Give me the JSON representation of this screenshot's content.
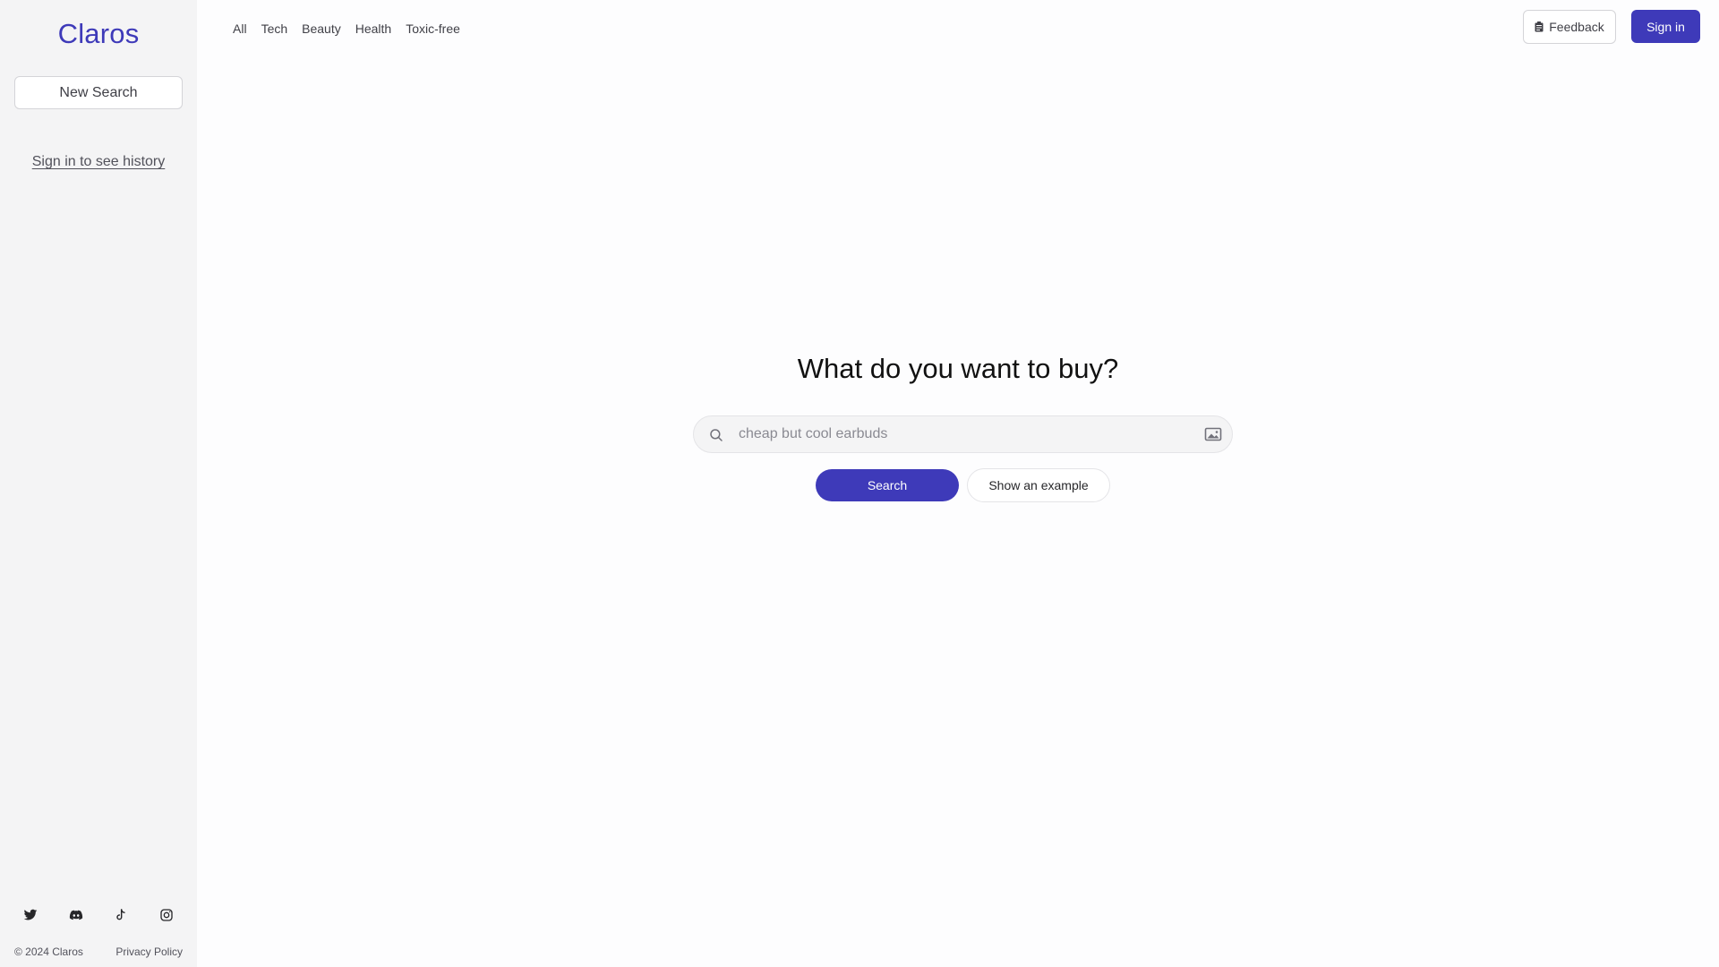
{
  "sidebar": {
    "logo": "Claros",
    "new_search_label": "New Search",
    "history_link": "Sign in to see history",
    "social_icons": [
      "twitter-icon",
      "discord-icon",
      "tiktok-icon",
      "instagram-icon"
    ],
    "copyright": "© 2024 Claros",
    "privacy_link": "Privacy Policy"
  },
  "topnav": {
    "items": [
      {
        "label": "All"
      },
      {
        "label": "Tech"
      },
      {
        "label": "Beauty"
      },
      {
        "label": "Health"
      },
      {
        "label": "Toxic-free"
      }
    ],
    "feedback_label": "Feedback",
    "signin_label": "Sign in"
  },
  "main": {
    "headline": "What do you want to buy?",
    "search": {
      "placeholder": "cheap but cool earbuds",
      "value": ""
    },
    "search_button": "Search",
    "example_button": "Show an example"
  },
  "colors": {
    "brand": "#3e3ab9",
    "sidebar_bg": "#f4f4f5",
    "page_bg": "#fdfdfe"
  }
}
